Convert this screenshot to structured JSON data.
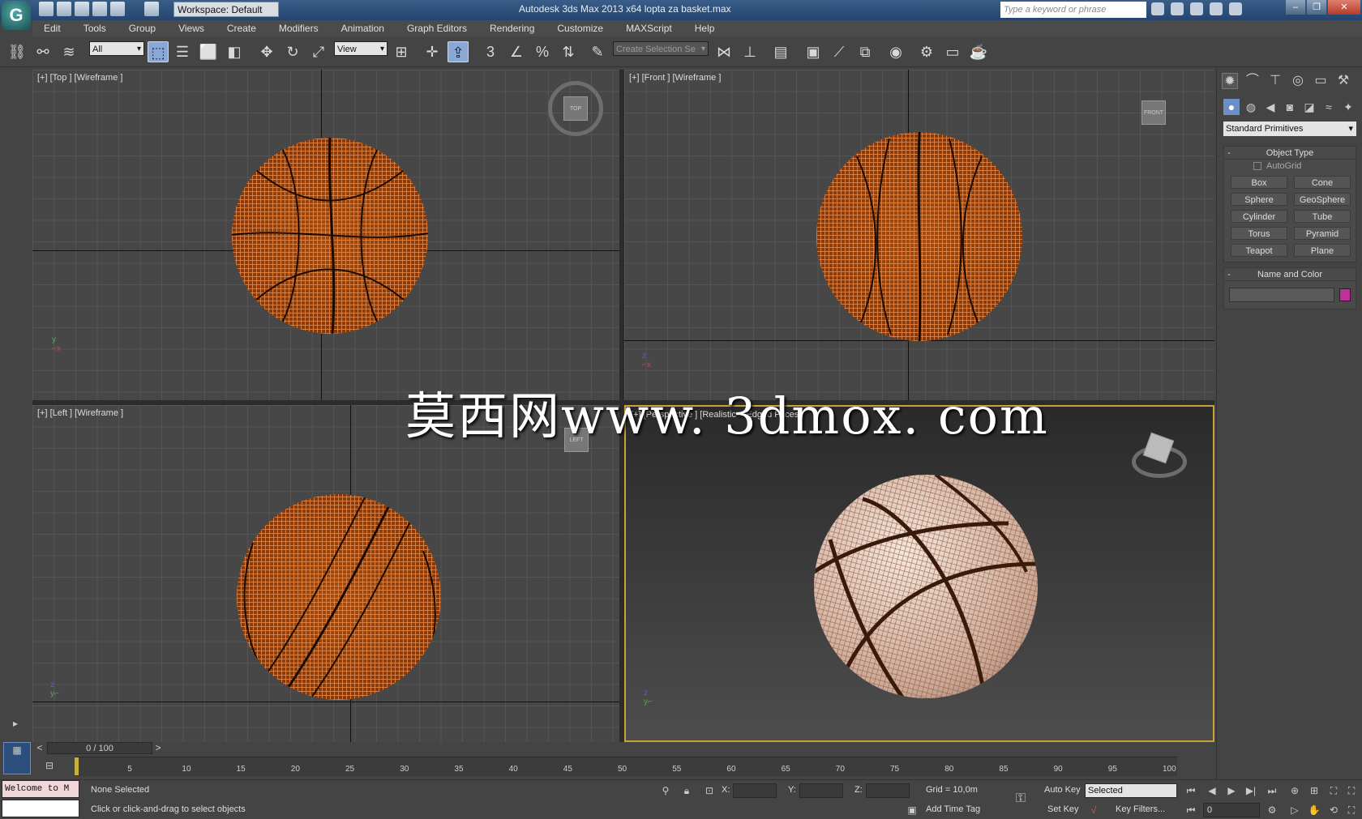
{
  "window": {
    "app_icon": "3ds-max-logo",
    "workspace": "Workspace: Default",
    "title": "Autodesk 3ds Max  2013 x64      lopta za basket.max",
    "search_placeholder": "Type a keyword or phrase"
  },
  "menu": [
    "Edit",
    "Tools",
    "Group",
    "Views",
    "Create",
    "Modifiers",
    "Animation",
    "Graph Editors",
    "Rendering",
    "Customize",
    "MAXScript",
    "Help"
  ],
  "toolbar": {
    "selection_filter": "All",
    "reference_coord": "View",
    "named_selection": "Create Selection Se"
  },
  "viewports": {
    "top": {
      "label": "[+] [Top ] [Wireframe ]",
      "cube": "TOP"
    },
    "front": {
      "label": "[+] [Front ] [Wireframe ]",
      "cube": "FRONT"
    },
    "left": {
      "label": "[+] [Left ] [Wireframe ]",
      "cube": "LEFT"
    },
    "perspective": {
      "label": "[+] [Perspective ] [Realistic + Edged Faces ]"
    }
  },
  "watermark": "莫西网www. 3dmox. com",
  "command_panel": {
    "dropdown": "Standard Primitives",
    "object_type_title": "Object Type",
    "autogrid": "AutoGrid",
    "buttons": [
      "Box",
      "Cone",
      "Sphere",
      "GeoSphere",
      "Cylinder",
      "Tube",
      "Torus",
      "Pyramid",
      "Teapot",
      "Plane"
    ],
    "name_color_title": "Name and Color",
    "object_color": "#c0309a"
  },
  "timeline": {
    "frame": "0 / 100",
    "ticks": [
      "5",
      "10",
      "15",
      "20",
      "25",
      "30",
      "35",
      "40",
      "45",
      "50",
      "55",
      "60",
      "65",
      "70",
      "75",
      "80",
      "85",
      "90",
      "95",
      "100"
    ]
  },
  "status": {
    "listener": "Welcome to M",
    "selection": "None Selected",
    "prompt": "Click or click-and-drag to select objects",
    "x_label": "X:",
    "y_label": "Y:",
    "z_label": "Z:",
    "grid": "Grid = 10,0m",
    "add_time_tag": "Add Time Tag",
    "auto_key": "Auto Key",
    "set_key": "Set Key",
    "key_mode": "Selected",
    "key_filters": "Key Filters...",
    "current_frame": "0"
  }
}
